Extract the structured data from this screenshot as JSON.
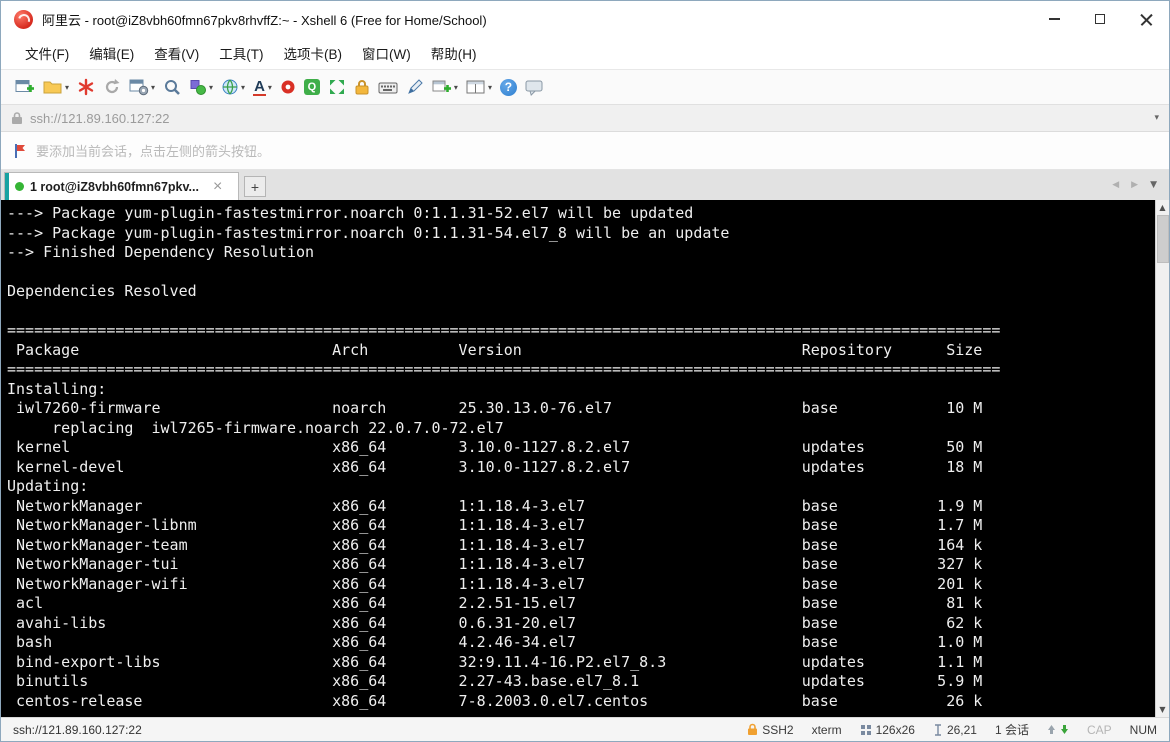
{
  "window": {
    "title": "阿里云 - root@iZ8vbh60fmn67pkv8rhvffZ:~ - Xshell 6 (Free for Home/School)"
  },
  "menu_bar": {
    "items": [
      "文件(F)",
      "编辑(E)",
      "查看(V)",
      "工具(T)",
      "选项卡(B)",
      "窗口(W)",
      "帮助(H)"
    ]
  },
  "toolbar": {
    "font_glyph": "A",
    "quick_glyph": "Q",
    "help_glyph": "?"
  },
  "address_bar": {
    "url": "ssh://121.89.160.127:22",
    "caret_glyph": "▾"
  },
  "notice_bar": {
    "text": "要添加当前会话，点击左侧的箭头按钮。"
  },
  "tab_bar": {
    "tabs": [
      {
        "label": "1 root@iZ8vbh60fmn67pkv...",
        "close_glyph": "×"
      }
    ],
    "new_tab_glyph": "+",
    "nav_left_glyph": "◀",
    "nav_right_glyph": "▶",
    "nav_menu_glyph": "▼",
    "scroll_up_glyph": "▲",
    "scroll_down_glyph": "▼"
  },
  "colors": {
    "terminal_bg": "#000000",
    "terminal_fg": "#efefef",
    "tab_accent": "#17a2a2",
    "tab_dot_green": "#35b535",
    "logo_red": "#d62b1f",
    "status_lock_orange": "#f0a030"
  },
  "terminal": {
    "pre_lines": [
      "---> Package yum-plugin-fastestmirror.noarch 0:1.1.31-52.el7 will be updated",
      "---> Package yum-plugin-fastestmirror.noarch 0:1.1.31-54.el7_8 will be an update",
      "--> Finished Dependency Resolution",
      "",
      "Dependencies Resolved",
      ""
    ],
    "table": {
      "separator_width": 110,
      "cols": {
        "name": 1,
        "arch": 36,
        "version": 50,
        "repo": 88,
        "size_end": 108
      },
      "header": {
        "name": "Package",
        "arch": "Arch",
        "version": "Version",
        "repo": "Repository",
        "size": "Size"
      },
      "sections": [
        {
          "title": "Installing:",
          "rows": [
            {
              "name": "iwl7260-firmware",
              "arch": "noarch",
              "version": "25.30.13.0-76.el7",
              "repo": "base",
              "size": "10 M",
              "note": "     replacing  iwl7265-firmware.noarch 22.0.7.0-72.el7"
            },
            {
              "name": "kernel",
              "arch": "x86_64",
              "version": "3.10.0-1127.8.2.el7",
              "repo": "updates",
              "size": "50 M"
            },
            {
              "name": "kernel-devel",
              "arch": "x86_64",
              "version": "3.10.0-1127.8.2.el7",
              "repo": "updates",
              "size": "18 M"
            }
          ]
        },
        {
          "title": "Updating:",
          "rows": [
            {
              "name": "NetworkManager",
              "arch": "x86_64",
              "version": "1:1.18.4-3.el7",
              "repo": "base",
              "size": "1.9 M"
            },
            {
              "name": "NetworkManager-libnm",
              "arch": "x86_64",
              "version": "1:1.18.4-3.el7",
              "repo": "base",
              "size": "1.7 M"
            },
            {
              "name": "NetworkManager-team",
              "arch": "x86_64",
              "version": "1:1.18.4-3.el7",
              "repo": "base",
              "size": "164 k"
            },
            {
              "name": "NetworkManager-tui",
              "arch": "x86_64",
              "version": "1:1.18.4-3.el7",
              "repo": "base",
              "size": "327 k"
            },
            {
              "name": "NetworkManager-wifi",
              "arch": "x86_64",
              "version": "1:1.18.4-3.el7",
              "repo": "base",
              "size": "201 k"
            },
            {
              "name": "acl",
              "arch": "x86_64",
              "version": "2.2.51-15.el7",
              "repo": "base",
              "size": "81 k"
            },
            {
              "name": "avahi-libs",
              "arch": "x86_64",
              "version": "0.6.31-20.el7",
              "repo": "base",
              "size": "62 k"
            },
            {
              "name": "bash",
              "arch": "x86_64",
              "version": "4.2.46-34.el7",
              "repo": "base",
              "size": "1.0 M"
            },
            {
              "name": "bind-export-libs",
              "arch": "x86_64",
              "version": "32:9.11.4-16.P2.el7_8.3",
              "repo": "updates",
              "size": "1.1 M"
            },
            {
              "name": "binutils",
              "arch": "x86_64",
              "version": "2.27-43.base.el7_8.1",
              "repo": "updates",
              "size": "5.9 M"
            },
            {
              "name": "centos-release",
              "arch": "x86_64",
              "version": "7-8.2003.0.el7.centos",
              "repo": "base",
              "size": "26 k"
            }
          ]
        }
      ]
    }
  },
  "status_bar": {
    "address": "ssh://121.89.160.127:22",
    "protocol": "SSH2",
    "terminal_type": "xterm",
    "screen_size": "126x26",
    "cursor_position": "26,21",
    "session_count": "1 会话",
    "caps_indicator": "CAP",
    "num_indicator": "NUM"
  }
}
